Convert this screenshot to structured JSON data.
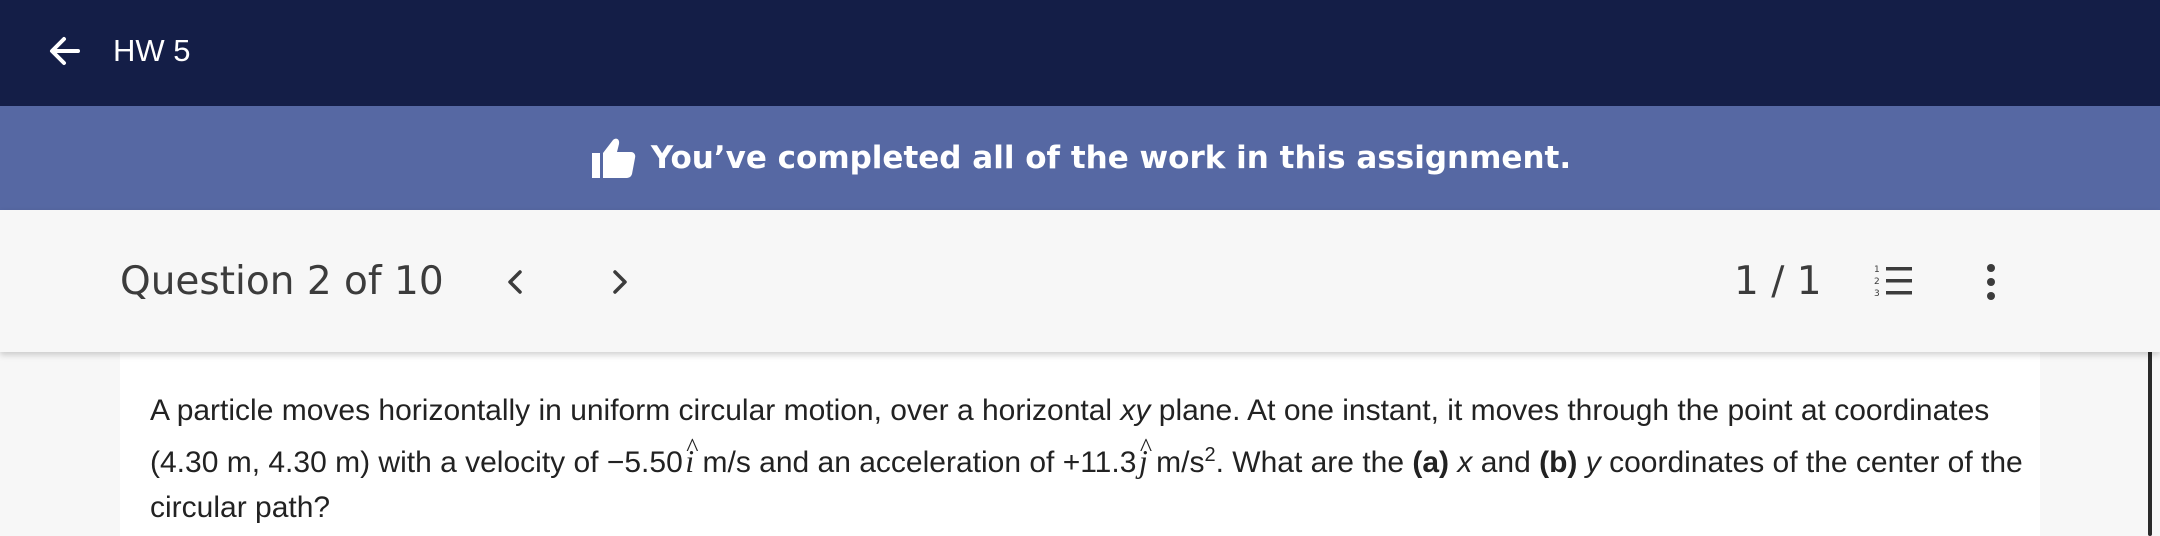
{
  "topbar": {
    "title": "HW 5"
  },
  "banner": {
    "message": "You’ve completed all of the work in this assignment."
  },
  "question_bar": {
    "label": "Question 2 of 10",
    "score": "1 / 1"
  },
  "question": {
    "part1": "A particle moves horizontally in uniform circular motion, over a horizontal ",
    "xy": "xy",
    "part2": " plane. At one instant, it moves through the point at coordinates (4.30 m, 4.30 m) with a velocity of −5.50",
    "i_hat": "i",
    "part3": " m/s and an acceleration of +11.3",
    "j_hat": "j",
    "part4": " m/s",
    "sup": "2",
    "part5": ". What are the ",
    "a_label": "(a)",
    "x": "x",
    "part6": " and ",
    "b_label": "(b)",
    "y": "y",
    "part7": " coordinates of the center of the circular path?"
  },
  "colors": {
    "topbar": "#141e47",
    "banner": "#5668a3",
    "page": "#f7f7f7"
  },
  "icons": [
    "arrow-left-icon",
    "thumbs-up-icon",
    "chevron-left-icon",
    "chevron-right-icon",
    "numbered-list-icon",
    "more-vertical-icon"
  ]
}
